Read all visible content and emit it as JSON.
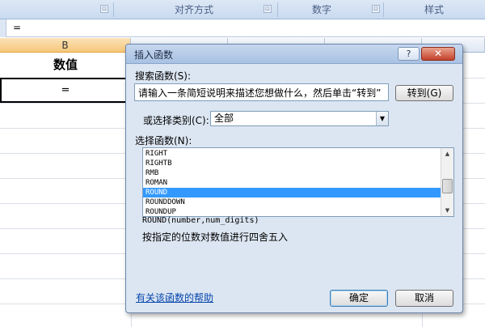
{
  "ribbon": {
    "groups": [
      {
        "label": ""
      },
      {
        "label": "对齐方式"
      },
      {
        "label": "数字"
      },
      {
        "label": "样式"
      }
    ],
    "launcher_glyph": "⊡"
  },
  "formula_bar": {
    "value": "="
  },
  "grid": {
    "column_b": "B",
    "header_cell": "数值",
    "active_cell_value": "="
  },
  "dialog": {
    "title": "插入函数",
    "help_button": "?",
    "close_button": "✕",
    "search_label": "搜索函数(S):",
    "search_value": "请输入一条简短说明来描述您想做什么，然后单击“转到”",
    "go_button": "转到(G)",
    "category_label": "或选择类别(C):",
    "category_value": "全部",
    "function_label": "选择函数(N):",
    "functions": [
      "RIGHT",
      "RIGHTB",
      "RMB",
      "ROMAN",
      "ROUND",
      "ROUNDDOWN",
      "ROUNDUP"
    ],
    "selected_function": "ROUND",
    "syntax": "ROUND(number,num_digits)",
    "description": "按指定的位数对数值进行四舍五入",
    "help_link": "有关该函数的帮助",
    "ok_button": "确定",
    "cancel_button": "取消"
  },
  "colors": {
    "selection": "#3399ff",
    "link": "#0645ad",
    "dialog_bg": "#dce6f2",
    "close": "#c4412a"
  }
}
